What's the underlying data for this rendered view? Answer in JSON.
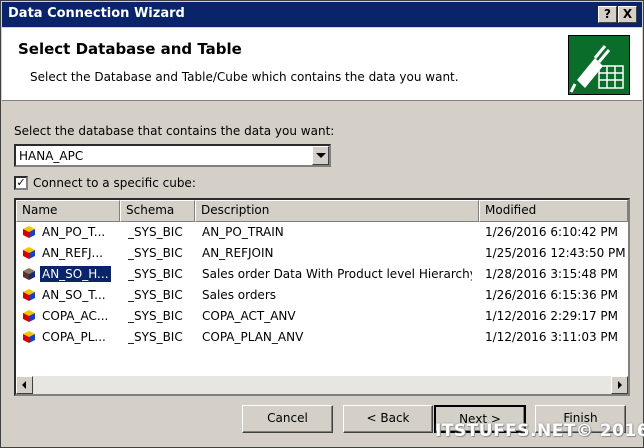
{
  "window": {
    "title": "Data Connection Wizard",
    "help_label": "?",
    "close_label": "X"
  },
  "header": {
    "title": "Select Database and Table",
    "subtitle": "Select the Database and Table/Cube which contains the data you want."
  },
  "database": {
    "label": "Select the database that contains the data you want:",
    "value": "HANA_APC"
  },
  "cube": {
    "checked": true,
    "check_mark": "✓",
    "label": "Connect to a specific cube:"
  },
  "table": {
    "columns": [
      "Name",
      "Schema",
      "Description",
      "Modified"
    ],
    "rows": [
      {
        "name": "AN_PO_T...",
        "schema": "_SYS_BIC",
        "description": "AN_PO_TRAIN",
        "modified": "1/26/2016 6:10:42 PM",
        "selected": false
      },
      {
        "name": "AN_REFJ...",
        "schema": "_SYS_BIC",
        "description": "AN_REFJOIN",
        "modified": "1/25/2016 12:43:50 PM",
        "selected": false
      },
      {
        "name": "AN_SO_H...",
        "schema": "_SYS_BIC",
        "description": "Sales order Data With Product level Hierarchy",
        "modified": "1/28/2016 3:15:48 PM",
        "selected": true
      },
      {
        "name": "AN_SO_T...",
        "schema": "_SYS_BIC",
        "description": "Sales orders",
        "modified": "1/26/2016 6:15:36 PM",
        "selected": false
      },
      {
        "name": "COPA_AC...",
        "schema": "_SYS_BIC",
        "description": "COPA_ACT_ANV",
        "modified": "1/12/2016 2:29:17 PM",
        "selected": false
      },
      {
        "name": "COPA_PL...",
        "schema": "_SYS_BIC",
        "description": "COPA_PLAN_ANV",
        "modified": "1/12/2016 3:11:03 PM",
        "selected": false
      }
    ]
  },
  "buttons": {
    "cancel": "Cancel",
    "back": "< Back",
    "next": "Next >",
    "finish": "Finish"
  },
  "watermark": "ITSTUFFS.NET© 2016",
  "colors": {
    "titlebar": "#0a246a",
    "selection": "#0a246a",
    "icon_bg": "#0a6e2a"
  }
}
